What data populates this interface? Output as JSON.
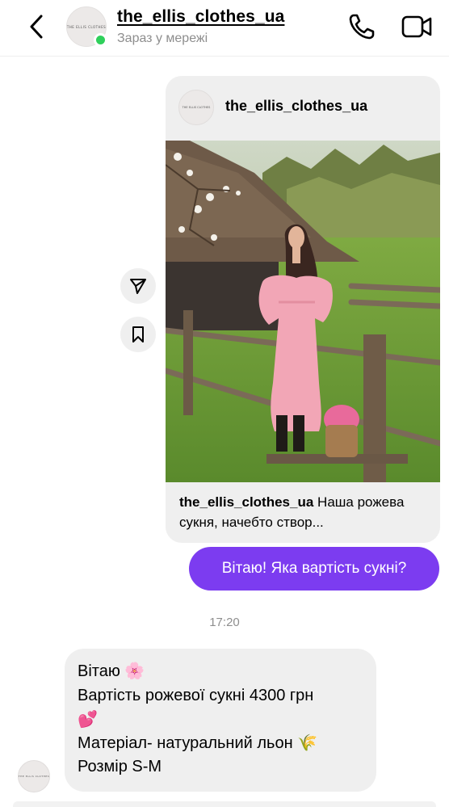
{
  "header": {
    "username": "the_ellis_clothes_ua",
    "status": "Зараз у мережі",
    "avatar_logo_text": "THE ELLIS CLOTHES"
  },
  "post": {
    "username": "the_ellis_clothes_ua",
    "caption_user": "the_ellis_clothes_ua",
    "caption_text": "Наша рожева сукня, начебто створ..."
  },
  "messages": {
    "outgoing_text": "Вітаю! Яка вартість сукні?",
    "timestamp": "17:20",
    "incoming_lines": [
      "Вітаю 🌸",
      "Вартість рожевої сукні 4300 грн",
      "💕",
      "Матеріал- натуральний льон 🌾",
      "Розмір S-M"
    ]
  },
  "colors": {
    "accent": "#7c3cf0",
    "online": "#2fd05b",
    "bubble": "#efefef",
    "secondary_text": "#8e8e8e"
  },
  "icons": [
    "back-chevron-icon",
    "phone-icon",
    "video-camera-icon",
    "share-send-icon",
    "bookmark-icon"
  ]
}
